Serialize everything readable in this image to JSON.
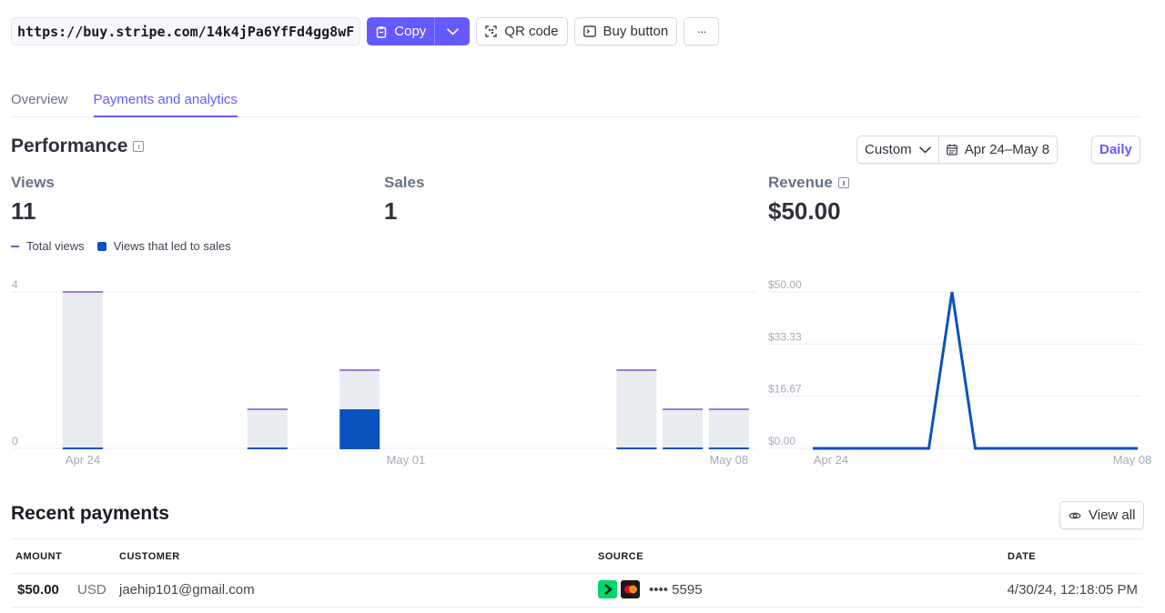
{
  "link_bar": {
    "url": "https://buy.stripe.com/14k4jPa6YfFd4gg8wF",
    "copy_label": "Copy",
    "qr_label": "QR code",
    "buy_button_label": "Buy button",
    "more_label": "···"
  },
  "tabs": [
    {
      "label": "Overview",
      "active": false
    },
    {
      "label": "Payments and analytics",
      "active": true
    }
  ],
  "performance": {
    "title": "Performance",
    "range_select": "Custom",
    "date_range": "Apr 24–May 8",
    "interval": "Daily",
    "metrics": {
      "views": {
        "label": "Views",
        "value": "11"
      },
      "sales": {
        "label": "Sales",
        "value": "1"
      },
      "revenue": {
        "label": "Revenue",
        "value": "$50.00"
      }
    },
    "legend": {
      "total_views": "Total views",
      "views_to_sales": "Views that led to sales"
    }
  },
  "colors": {
    "accent": "#635bff",
    "sales_bar": "#0a53be",
    "views_bar": "#e9edf1",
    "line": "#0a53be"
  },
  "chart_data": [
    {
      "type": "bar",
      "categories": [
        "Apr 24",
        "Apr 25",
        "Apr 26",
        "Apr 27",
        "Apr 28",
        "Apr 29",
        "Apr 30",
        "May 01",
        "May 02",
        "May 03",
        "May 04",
        "May 05",
        "May 06",
        "May 07",
        "May 08"
      ],
      "series": [
        {
          "name": "Total views",
          "values": [
            4,
            0,
            0,
            0,
            1,
            0,
            2,
            0,
            0,
            0,
            0,
            0,
            2,
            1,
            1
          ]
        },
        {
          "name": "Views that led to sales",
          "values": [
            0,
            0,
            0,
            0,
            0,
            0,
            1,
            0,
            0,
            0,
            0,
            0,
            0,
            0,
            0
          ]
        }
      ],
      "x_tick_labels": [
        "Apr 24",
        "May 01",
        "May 08"
      ],
      "y_tick_labels": [
        "4",
        "0"
      ],
      "ylim": [
        0,
        4
      ],
      "grid": true
    },
    {
      "type": "line",
      "x": [
        "Apr 24",
        "Apr 25",
        "Apr 26",
        "Apr 27",
        "Apr 28",
        "Apr 29",
        "Apr 30",
        "May 01",
        "May 02",
        "May 03",
        "May 04",
        "May 05",
        "May 06",
        "May 07",
        "May 08"
      ],
      "series": [
        {
          "values": [
            0,
            0,
            0,
            0,
            0,
            0,
            50,
            0,
            0,
            0,
            0,
            0,
            0,
            0,
            0
          ]
        }
      ],
      "x_tick_labels": [
        "Apr 24",
        "May 08"
      ],
      "y_tick_labels": [
        "$50.00",
        "$33.33",
        "$16.67",
        "$0.00"
      ],
      "ylim": [
        0,
        50
      ],
      "grid": true
    }
  ],
  "recent_payments": {
    "title": "Recent payments",
    "view_all": "View all",
    "columns": [
      "AMOUNT",
      "CUSTOMER",
      "SOURCE",
      "DATE"
    ],
    "rows": [
      {
        "amount": "$50.00",
        "currency": "USD",
        "customer": "jaehip101@gmail.com",
        "source": "•••• 5595",
        "date": "4/30/24, 12:18:05 PM"
      }
    ]
  }
}
